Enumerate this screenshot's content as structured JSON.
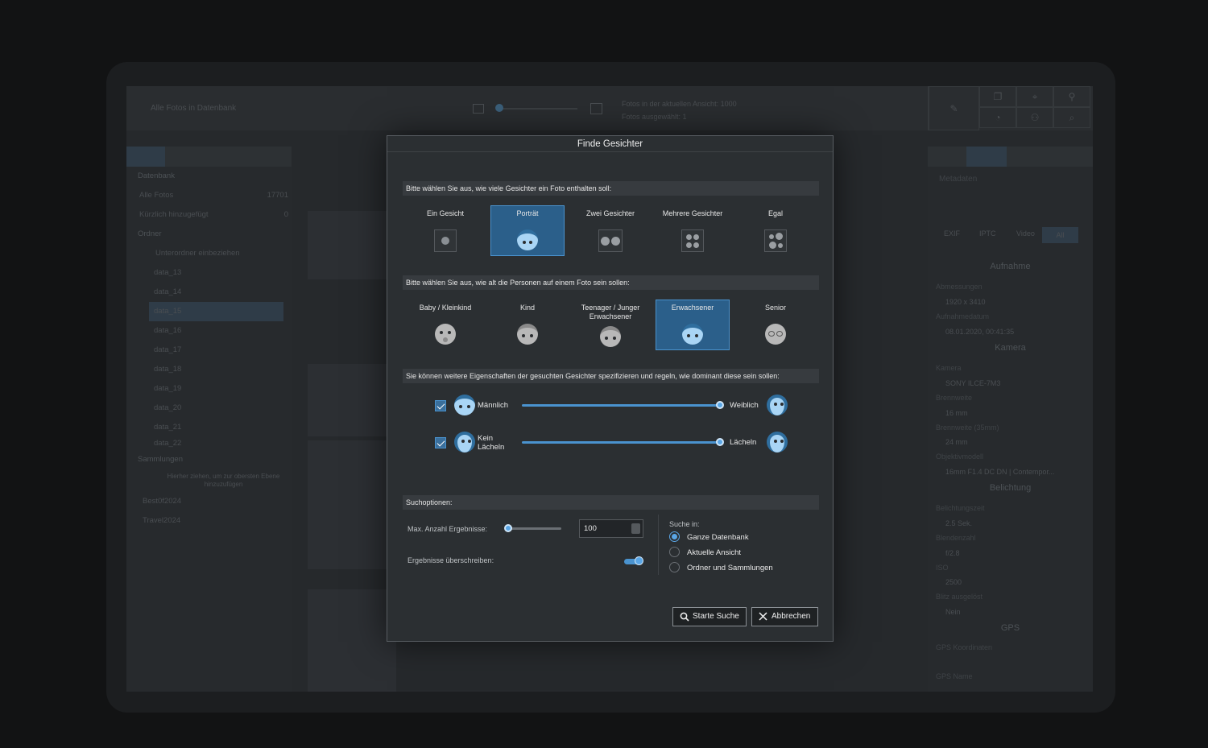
{
  "background_app": {
    "title": "Alle Fotos in Datenbank",
    "info_line1": "Fotos in der aktuellen Ansicht: 1000",
    "info_line2": "Fotos ausgewählt: 1",
    "sidebar": {
      "section_db": "Datenbank",
      "all_photos": "Alle Fotos",
      "all_photos_count": "17701",
      "recently_added": "Kürzlich hinzugefügt",
      "recently_added_count": "0",
      "section_folders": "Ordner",
      "include_subfolders": "Unterordner einbeziehen",
      "folders": [
        "data_13",
        "data_14",
        "data_15",
        "data_16",
        "data_17",
        "data_18",
        "data_19",
        "data_20",
        "data_21",
        "data_22"
      ],
      "section_collections": "Sammlungen",
      "collections_hint": "Hierher ziehen, um zur obersten Ebene hinzuzufügen",
      "collections": [
        "Best0f2024",
        "Travel2024"
      ]
    },
    "right_panel": {
      "title": "Metadaten",
      "tabs": [
        "EXIF",
        "IPTC",
        "Video",
        "All"
      ],
      "aufnahme": "Aufnahme",
      "dimensions_label": "Abmessungen",
      "dimensions": "1920 x 3410",
      "date_label": "Aufnahmedatum",
      "date": "08.01.2020, 00:41:35",
      "kamera": "Kamera",
      "camera_label": "Kamera",
      "camera": "SONY ILCE-7M3",
      "focal_label": "Brennweite",
      "focal": "16 mm",
      "focal35_label": "Brennweite (35mm)",
      "focal35": "24 mm",
      "lens_label": "Objektivmodell",
      "lens": "16mm F1.4 DC DN | Contempor...",
      "belichtung": "Belichtung",
      "exposure_label": "Belichtungszeit",
      "exposure": "2.5 Sek.",
      "aperture_label": "Blendenzahl",
      "aperture": "f/2.8",
      "iso_label": "ISO",
      "iso": "2500",
      "flash_label": "Blitz ausgelöst",
      "flash": "Nein",
      "gps": "GPS",
      "gps_coord_label": "GPS Koordinaten",
      "gps_name_label": "GPS Name"
    }
  },
  "dialog": {
    "title": "Finde Gesichter",
    "count_section": "Bitte wählen Sie aus, wie viele Gesichter ein Foto enthalten soll:",
    "count_options": [
      "Ein Gesicht",
      "Porträt",
      "Zwei Gesichter",
      "Mehrere Gesichter",
      "Egal"
    ],
    "count_selected": "Porträt",
    "age_section": "Bitte wählen Sie aus, wie alt die Personen auf einem Foto sein sollen:",
    "age_options": [
      "Baby / Kleinkind",
      "Kind",
      "Teenager / Junger Erwachsener",
      "Erwachsener",
      "Senior"
    ],
    "age_selected": "Erwachsener",
    "traits_section": "Sie können weitere Eigenschaften der gesuchten Gesichter spezifizieren und regeln, wie dominant diese sein sollen:",
    "gender_left": "Männlich",
    "gender_right": "Weiblich",
    "gender_value": 1.0,
    "smile_left": "Kein Lächeln",
    "smile_right": "Lächeln",
    "smile_value": 1.0,
    "search_options": "Suchoptionen:",
    "max_results_label": "Max. Anzahl Ergebnisse:",
    "max_results_value": "100",
    "overwrite_label": "Ergebnisse überschreiben:",
    "search_in_label": "Suche in:",
    "search_in_options": [
      "Ganze Datenbank",
      "Aktuelle Ansicht",
      "Ordner und Sammlungen"
    ],
    "search_in_selected": "Ganze Datenbank",
    "start_button": "Starte Suche",
    "cancel_button": "Abbrechen"
  },
  "colors": {
    "accent": "#4a93cf",
    "selected_bg": "#2b5f8a",
    "face_blue": "#a9d5f5",
    "face_gray": "#b8b8b8"
  }
}
